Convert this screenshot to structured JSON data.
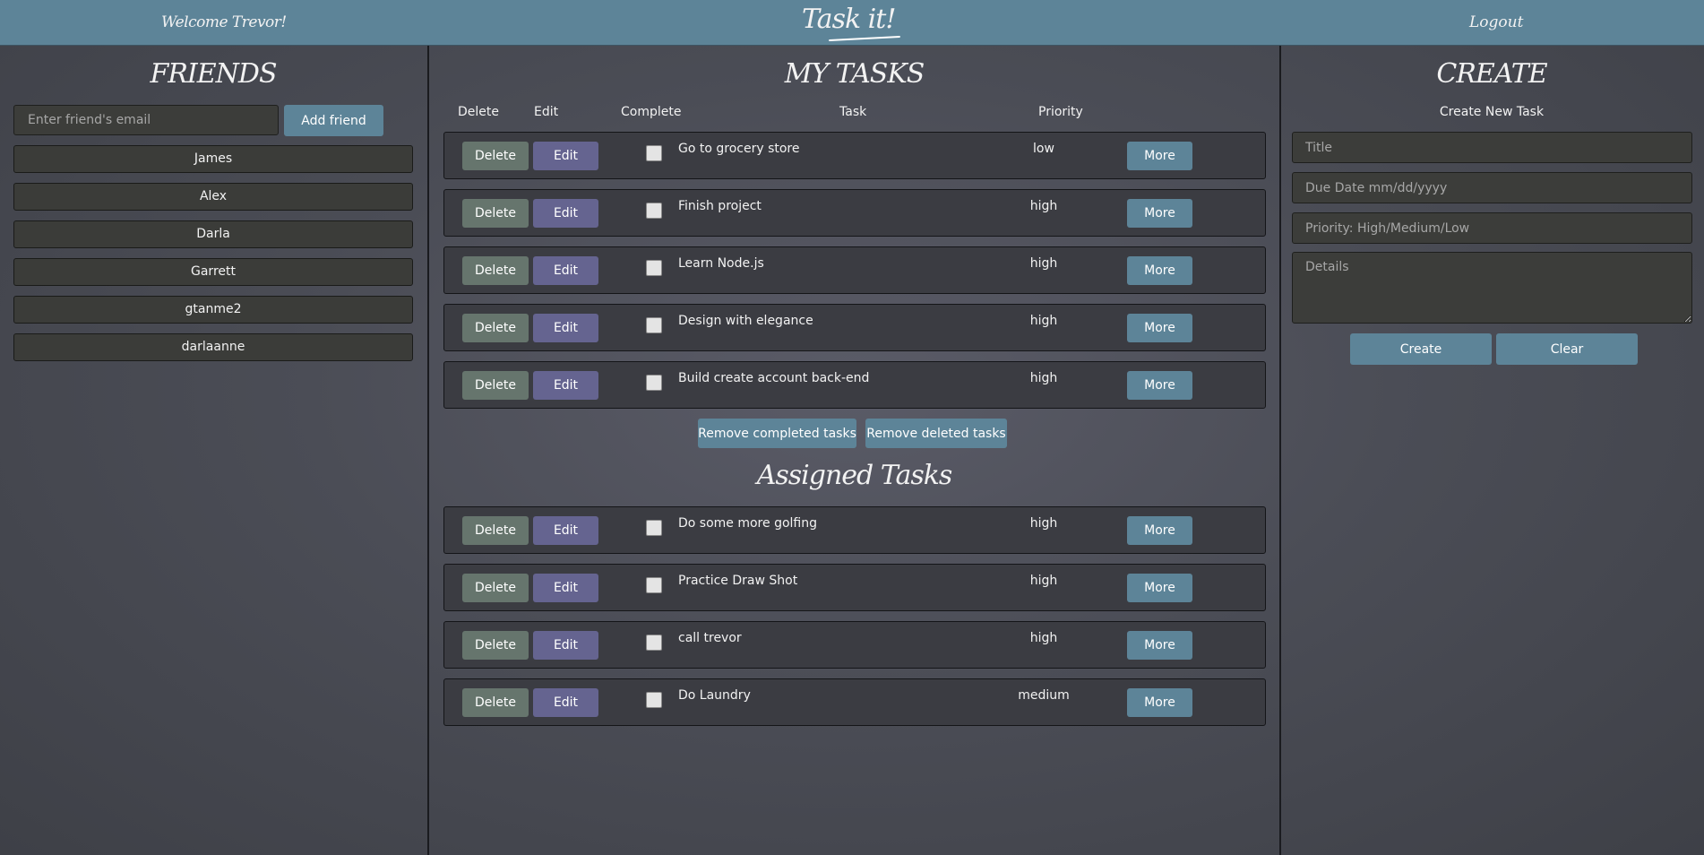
{
  "header": {
    "welcome": "Welcome Trevor!",
    "brand": "Task it!",
    "logout": "Logout"
  },
  "friends": {
    "title": "FRIENDS",
    "input_placeholder": "Enter friend's email",
    "add_label": "Add friend",
    "list": [
      "James",
      "Alex",
      "Darla",
      "Garrett",
      "gtanme2",
      "darlaanne"
    ]
  },
  "tasks": {
    "title": "MY TASKS",
    "columns": {
      "delete": "Delete",
      "edit": "Edit",
      "complete": "Complete",
      "task": "Task",
      "priority": "Priority"
    },
    "my_tasks": [
      {
        "delete": "Delete",
        "edit": "Edit",
        "name": "Go to grocery store",
        "priority": "low",
        "more": "More"
      },
      {
        "delete": "Delete",
        "edit": "Edit",
        "name": "Finish project",
        "priority": "high",
        "more": "More"
      },
      {
        "delete": "Delete",
        "edit": "Edit",
        "name": "Learn Node.js",
        "priority": "high",
        "more": "More"
      },
      {
        "delete": "Delete",
        "edit": "Edit",
        "name": "Design with elegance",
        "priority": "high",
        "more": "More"
      },
      {
        "delete": "Delete",
        "edit": "Edit",
        "name": "Build create account back-end",
        "priority": "high",
        "more": "More"
      }
    ],
    "remove_completed": "Remove completed tasks",
    "remove_deleted": "Remove deleted tasks",
    "assigned_title": "Assigned Tasks",
    "assigned_tasks": [
      {
        "delete": "Delete",
        "edit": "Edit",
        "name": "Do some more golfing",
        "priority": "high",
        "more": "More"
      },
      {
        "delete": "Delete",
        "edit": "Edit",
        "name": "Practice Draw Shot",
        "priority": "high",
        "more": "More"
      },
      {
        "delete": "Delete",
        "edit": "Edit",
        "name": "call trevor",
        "priority": "high",
        "more": "More"
      },
      {
        "delete": "Delete",
        "edit": "Edit",
        "name": "Do Laundry",
        "priority": "medium",
        "more": "More"
      }
    ]
  },
  "create": {
    "title": "CREATE",
    "subtitle": "Create New Task",
    "title_placeholder": "Title",
    "due_placeholder": "Due Date mm/dd/yyyy",
    "priority_placeholder": "Priority: High/Medium/Low",
    "details_placeholder": "Details",
    "create_label": "Create",
    "clear_label": "Clear"
  },
  "colors": {
    "topbar": "#5d8498",
    "button_blue": "#5d8498",
    "button_delete": "#66756d",
    "button_edit": "#656490"
  }
}
